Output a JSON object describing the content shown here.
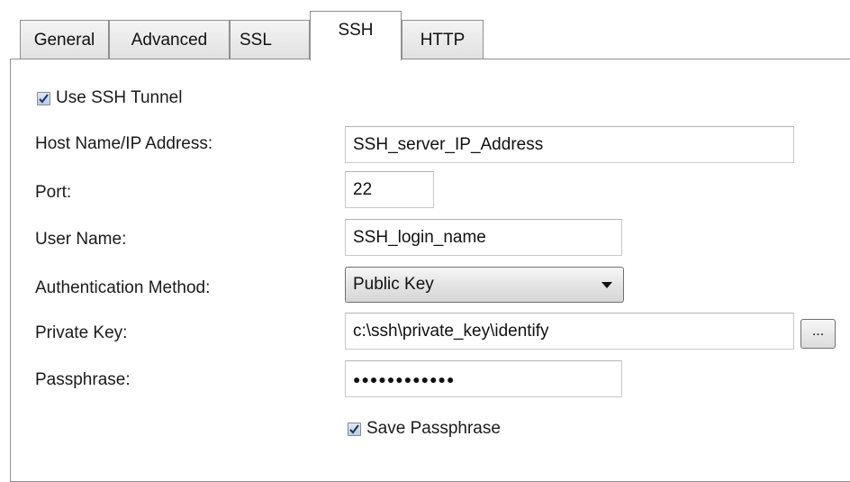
{
  "tabs": [
    {
      "label": "General"
    },
    {
      "label": "Advanced"
    },
    {
      "label": "SSL"
    },
    {
      "label": "SSH"
    },
    {
      "label": "HTTP"
    }
  ],
  "active_tab": "SSH",
  "ssh": {
    "use_tunnel_label": "Use SSH Tunnel",
    "use_tunnel_checked": true,
    "host_label": "Host Name/IP Address:",
    "host_value": "SSH_server_IP_Address",
    "port_label": "Port:",
    "port_value": "22",
    "user_label": "User Name:",
    "user_value": "SSH_login_name",
    "auth_label": "Authentication Method:",
    "auth_value": "Public Key",
    "private_key_label": "Private Key:",
    "private_key_value": "c:\\ssh\\private_key\\identify",
    "browse_label": "...",
    "passphrase_label": "Passphrase:",
    "passphrase_masked": "●●●●●●●●●●●●",
    "save_passphrase_label": "Save Passphrase",
    "save_passphrase_checked": true
  }
}
